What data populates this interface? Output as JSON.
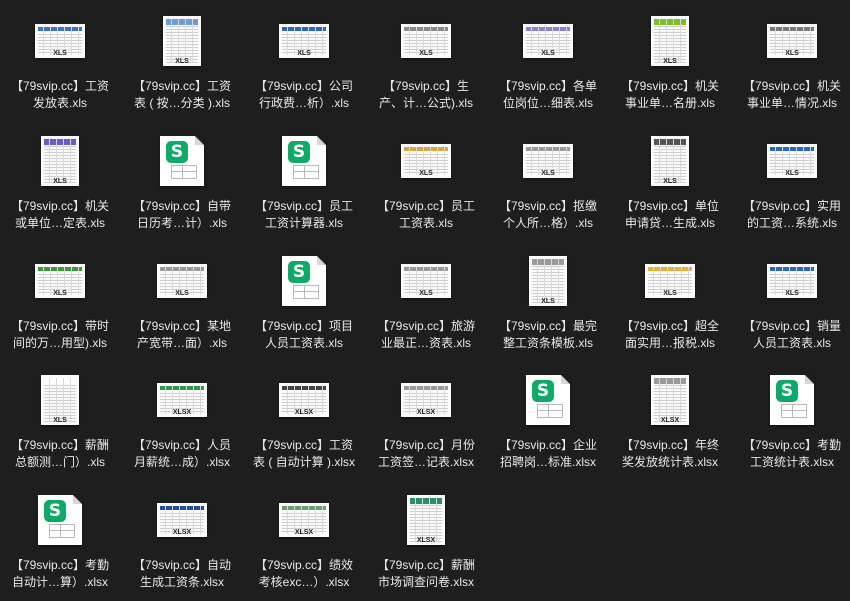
{
  "files": [
    {
      "name": "【79svip.cc】工资\n发放表.xls",
      "type": "XLS",
      "thumb": "sheet",
      "accent": "#3b73c7"
    },
    {
      "name": "【79svip.cc】工资\n表 ( 按…分类 ).xls",
      "type": "XLS",
      "thumb": "portrait",
      "accent": "#6f9bd6"
    },
    {
      "name": "【79svip.cc】公司\n行政费…析）.xls",
      "type": "XLS",
      "thumb": "sheet",
      "accent": "#2b67c2"
    },
    {
      "name": "【79svip.cc】生\n产、计…公式).xls",
      "type": "XLS",
      "thumb": "sheet",
      "accent": "#8a8a8a"
    },
    {
      "name": "【79svip.cc】各单\n位岗位…细表.xls",
      "type": "XLS",
      "thumb": "sheet",
      "accent": "#8e7fd6"
    },
    {
      "name": "【79svip.cc】机关\n事业单…名册.xls",
      "type": "XLS",
      "thumb": "portrait",
      "accent": "#7cbb2a"
    },
    {
      "name": "【79svip.cc】机关\n事业单…情况.xls",
      "type": "XLS",
      "thumb": "sheet",
      "accent": "#7a7a7a"
    },
    {
      "name": "【79svip.cc】机关\n或单位…定表.xls",
      "type": "XLS",
      "thumb": "portrait",
      "accent": "#6a5acd"
    },
    {
      "name": "【79svip.cc】自带\n日历考…计）.xls",
      "type": "S",
      "thumb": "wps",
      "accent": "#0fa968"
    },
    {
      "name": "【79svip.cc】员工\n工资计算器.xls",
      "type": "S",
      "thumb": "wps",
      "accent": "#0fa968"
    },
    {
      "name": "【79svip.cc】员工\n工资表.xls",
      "type": "XLS",
      "thumb": "sheet",
      "accent": "#d9a441"
    },
    {
      "name": "【79svip.cc】抠缴\n个人所…格）.xls",
      "type": "XLS",
      "thumb": "sheet",
      "accent": "#9a9a9a"
    },
    {
      "name": "【79svip.cc】单位\n申请贷…生成.xls",
      "type": "XLS",
      "thumb": "portrait",
      "accent": "#555555"
    },
    {
      "name": "【79svip.cc】实用\n的工资…系统.xls",
      "type": "XLS",
      "thumb": "sheet",
      "accent": "#2b67c2"
    },
    {
      "name": "【79svip.cc】带时\n间的万…用型).xls",
      "type": "XLS",
      "thumb": "sheet",
      "accent": "#3a9a3a"
    },
    {
      "name": "【79svip.cc】某地\n产宽带…面）.xls",
      "type": "XLS",
      "thumb": "sheet",
      "accent": "#9a9a9a"
    },
    {
      "name": "【79svip.cc】项目\n人员工资表.xls",
      "type": "S",
      "thumb": "wps",
      "accent": "#0fa968"
    },
    {
      "name": "【79svip.cc】旅游\n业最正…资表.xls",
      "type": "XLS",
      "thumb": "sheet",
      "accent": "#9a9a9a"
    },
    {
      "name": "【79svip.cc】最完\n整工资条模板.xls",
      "type": "XLS",
      "thumb": "portrait",
      "accent": "#9a9a9a"
    },
    {
      "name": "【79svip.cc】超全\n面实用…报税.xls",
      "type": "XLS",
      "thumb": "sheet",
      "accent": "#e0b23a"
    },
    {
      "name": "【79svip.cc】销量\n人员工资表.xls",
      "type": "XLS",
      "thumb": "sheet",
      "accent": "#2b67c2"
    },
    {
      "name": "【79svip.cc】薪酬\n总额测…门）.xls",
      "type": "XLS",
      "thumb": "portrait",
      "accent": "#ffffff"
    },
    {
      "name": "【79svip.cc】人员\n月薪统…成）.xlsx",
      "type": "XLSX",
      "thumb": "sheet",
      "accent": "#2e9a4e"
    },
    {
      "name": "【79svip.cc】工资\n表 ( 自动计算 ).xlsx",
      "type": "XLSX",
      "thumb": "sheet",
      "accent": "#444444"
    },
    {
      "name": "【79svip.cc】月份\n工资签…记表.xlsx",
      "type": "XLSX",
      "thumb": "sheet",
      "accent": "#9a9a9a"
    },
    {
      "name": "【79svip.cc】企业\n招聘岗…标准.xlsx",
      "type": "S",
      "thumb": "wps",
      "accent": "#0fa968"
    },
    {
      "name": "【79svip.cc】年终\n奖发放统计表.xlsx",
      "type": "XLSX",
      "thumb": "portrait",
      "accent": "#9a9a9a"
    },
    {
      "name": "【79svip.cc】考勤\n工资统计表.xlsx",
      "type": "S",
      "thumb": "wps",
      "accent": "#0fa968"
    },
    {
      "name": "【79svip.cc】考勤\n自动计…算）.xlsx",
      "type": "S",
      "thumb": "wps",
      "accent": "#0fa968"
    },
    {
      "name": "【79svip.cc】自动\n生成工资条.xlsx",
      "type": "XLSX",
      "thumb": "sheet",
      "accent": "#1f4f9a"
    },
    {
      "name": "【79svip.cc】绩效\n考核exc…）.xlsx",
      "type": "XLSX",
      "thumb": "sheet",
      "accent": "#6aa06a"
    },
    {
      "name": "【79svip.cc】薪酬\n市场调查问卷.xlsx",
      "type": "XLSX",
      "thumb": "portrait",
      "accent": "#2a8f6a"
    }
  ]
}
